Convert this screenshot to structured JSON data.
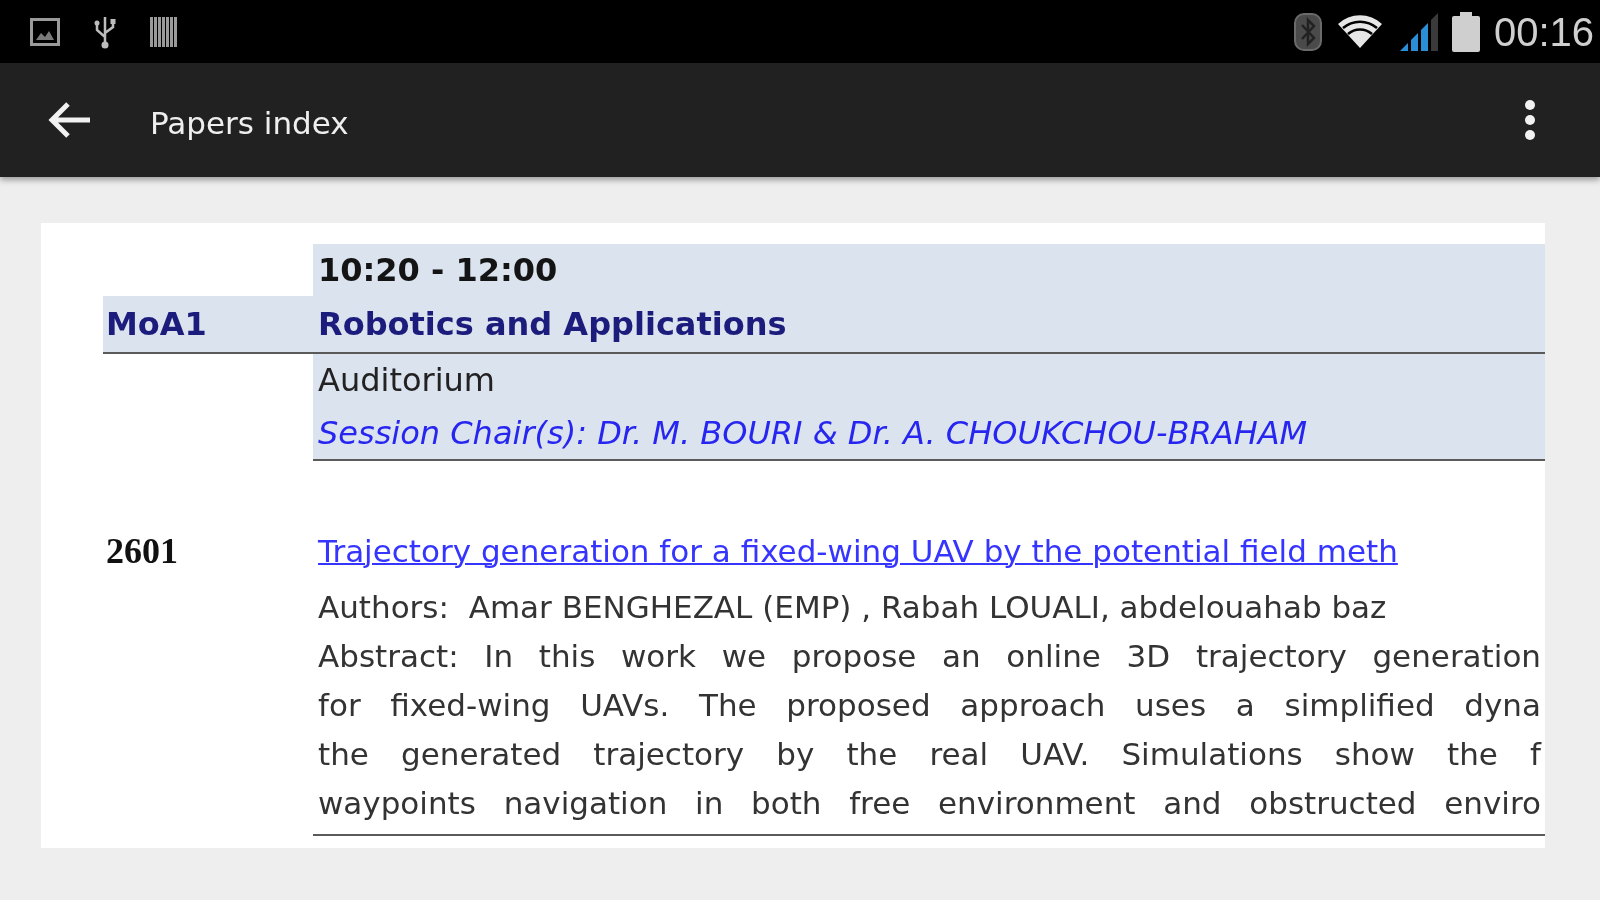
{
  "status_bar": {
    "time": "00:16"
  },
  "app_bar": {
    "title": "Papers index"
  },
  "session": {
    "time": "10:20 - 12:00",
    "code": "MoA1",
    "title": "Robotics and Applications",
    "room": "Auditorium",
    "chairs": "Session Chair(s): Dr. M. BOURI & Dr. A. CHOUKCHOU-BRAHAM"
  },
  "papers": [
    {
      "number": "2601",
      "title": "Trajectory generation for a fixed-wing UAV by the potential field meth",
      "authors": "Authors:  Amar BENGHEZAL (EMP) , Rabah LOUALI, abdelouahab baz",
      "abstract_lines": [
        "Abstract: In this work we propose an online 3D trajectory generation",
        "for fixed-wing UAVs. The proposed approach uses a simplified dyna",
        "the generated trajectory by the real UAV. Simulations show the f",
        "waypoints navigation in both free environment and obstructed enviro"
      ]
    }
  ]
}
